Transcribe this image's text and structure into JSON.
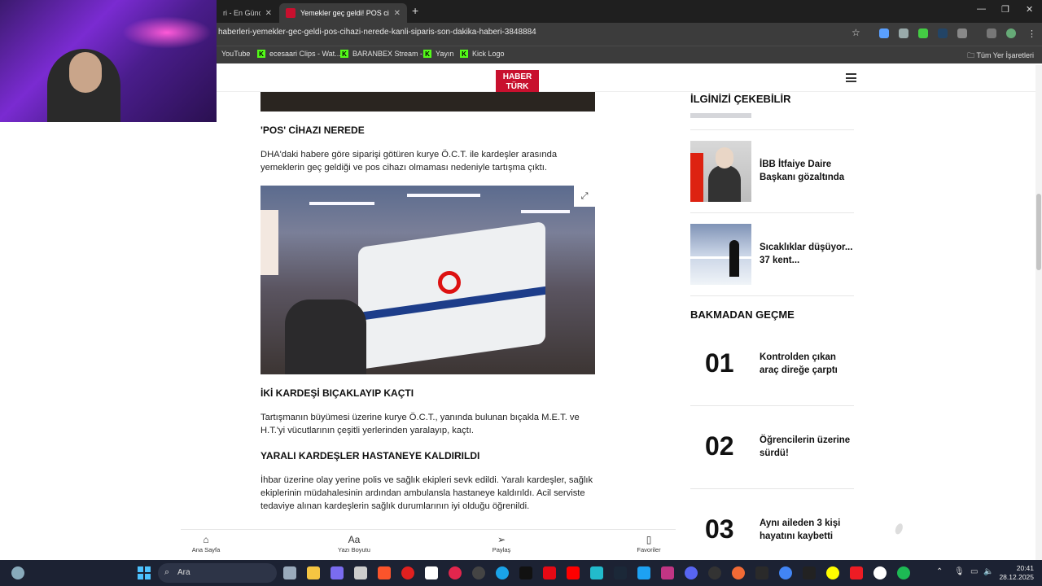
{
  "browser": {
    "tabs": [
      {
        "label": "ri - En Güncel",
        "active": false
      },
      {
        "label": "Yemekler geç geldi! POS cihazı",
        "active": true
      }
    ],
    "url": "haberleri-yemekler-gec-geldi-pos-cihazi-nerede-kanli-siparis-son-dakika-haberi-3848884",
    "bookmarks": [
      "YouTube",
      "ecesaari Clips - Wat...",
      "BARANBEX Stream -...",
      "Yayın",
      "Kick Logo"
    ],
    "all_bookmarks": "Tüm Yer İşaretleri"
  },
  "site": {
    "logo_line1": "HABER",
    "logo_line2": "TÜRK"
  },
  "article": {
    "heading1": "'POS' CİHAZI NEREDE",
    "para1": "DHA'daki habere göre siparişi götüren kurye Ö.C.T. ile kardeşler arasında yemeklerin geç geldiği ve pos cihazı olmaması nedeniyle tartışma çıktı.",
    "heading2": "İKİ KARDEŞİ BIÇAKLAYIP KAÇTI",
    "para2": "Tartışmanın büyümesi üzerine kurye Ö.C.T., yanında bulunan bıçakla M.E.T. ve H.T.'yi vücutlarının çeşitli yerlerinden yaralayıp, kaçtı.",
    "heading3": "YARALI KARDEŞLER HASTANEYE KALDIRILDI",
    "para3": "İhbar üzerine olay yerine polis ve sağlık ekipleri sevk edildi. Yaralı kardeşler, sağlık ekiplerinin müdahalesinin ardından ambulansla hastaneye kaldırıldı. Acil serviste tedaviye alınan kardeşlerin sağlık durumlarının iyi olduğu öğrenildi."
  },
  "sidebar": {
    "section1_title": "İLGİNİZİ ÇEKEBİLİR",
    "items": [
      {
        "title": "İBB İtfaiye Daire Başkanı gözaltında"
      },
      {
        "title": "Sıcaklıklar düşüyor... 37 kent..."
      }
    ],
    "section2_title": "BAKMADAN GEÇME",
    "ranked": [
      {
        "num": "01",
        "title": "Kontrolden çıkan araç direğe çarptı"
      },
      {
        "num": "02",
        "title": "Öğrencilerin üzerine sürdü!"
      },
      {
        "num": "03",
        "title": "Aynı aileden 3 kişi hayatını kaybetti"
      }
    ]
  },
  "bottom_nav": [
    {
      "label": "Ana Sayfa",
      "icon": "home-icon"
    },
    {
      "label": "Yazı Boyutu",
      "icon": "font-size-icon"
    },
    {
      "label": "Paylaş",
      "icon": "share-icon"
    },
    {
      "label": "Favoriler",
      "icon": "bookmark-icon"
    }
  ],
  "taskbar": {
    "search_placeholder": "Ara",
    "time": "20:41",
    "date": "28.12.2025"
  }
}
